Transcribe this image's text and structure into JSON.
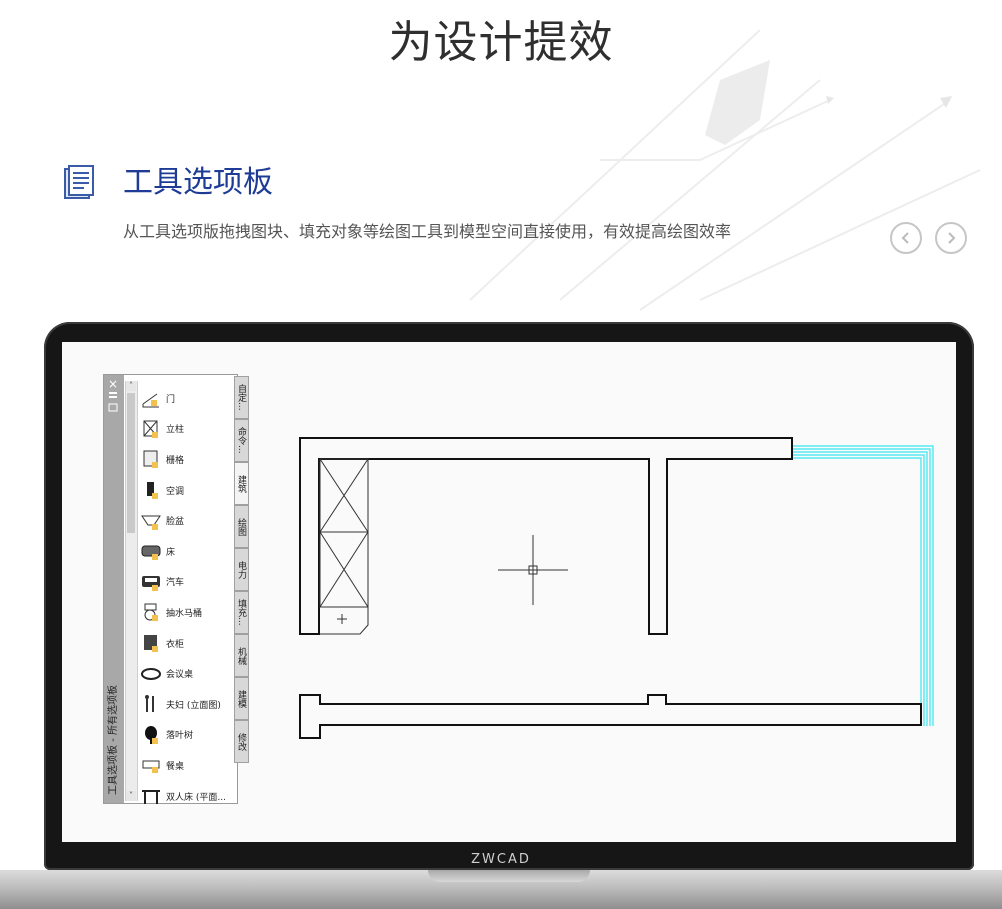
{
  "header": {
    "title": "为设计提效"
  },
  "feature": {
    "icon": "document-list-icon",
    "title": "工具选项板",
    "description": "从工具选项版拖拽图块、填充对象等绘图工具到模型空间直接使用，有效提高绘图效率"
  },
  "carousel": {
    "prev_icon": "chevron-left-icon",
    "next_icon": "chevron-right-icon"
  },
  "laptop": {
    "brand": "ZWCAD"
  },
  "palette": {
    "close_glyph": "×",
    "vertical_title": "工具选项板 - 所有选项板",
    "scroll_up": "˄",
    "scroll_down": "˅",
    "items": [
      {
        "label": "门",
        "icon": "door-icon"
      },
      {
        "label": "立柱",
        "icon": "column-icon"
      },
      {
        "label": "栅格",
        "icon": "grid-icon"
      },
      {
        "label": "空调",
        "icon": "air-conditioner-icon"
      },
      {
        "label": "脸盆",
        "icon": "washbasin-icon"
      },
      {
        "label": "床",
        "icon": "bed-icon"
      },
      {
        "label": "汽车",
        "icon": "car-icon"
      },
      {
        "label": "抽水马桶",
        "icon": "toilet-icon"
      },
      {
        "label": "衣柜",
        "icon": "wardrobe-icon"
      },
      {
        "label": "会议桌",
        "icon": "meeting-table-icon"
      },
      {
        "label": "夫妇 (立面图)",
        "icon": "couple-icon"
      },
      {
        "label": "落叶树",
        "icon": "tree-icon"
      },
      {
        "label": "餐桌",
        "icon": "dining-table-icon"
      },
      {
        "label": "双人床 (平面...",
        "icon": "double-bed-icon"
      }
    ],
    "tabs": [
      {
        "label": "自定...",
        "active": false
      },
      {
        "label": "命令...",
        "active": false
      },
      {
        "label": "建筑",
        "active": true
      },
      {
        "label": "绘图",
        "active": false
      },
      {
        "label": "电力",
        "active": false
      },
      {
        "label": "填充...",
        "active": false
      },
      {
        "label": "机械",
        "active": false
      },
      {
        "label": "建模",
        "active": false
      },
      {
        "label": "修改",
        "active": false
      }
    ]
  },
  "colors": {
    "title_blue": "#1e3c96",
    "selection_cyan": "#34e6f0"
  }
}
